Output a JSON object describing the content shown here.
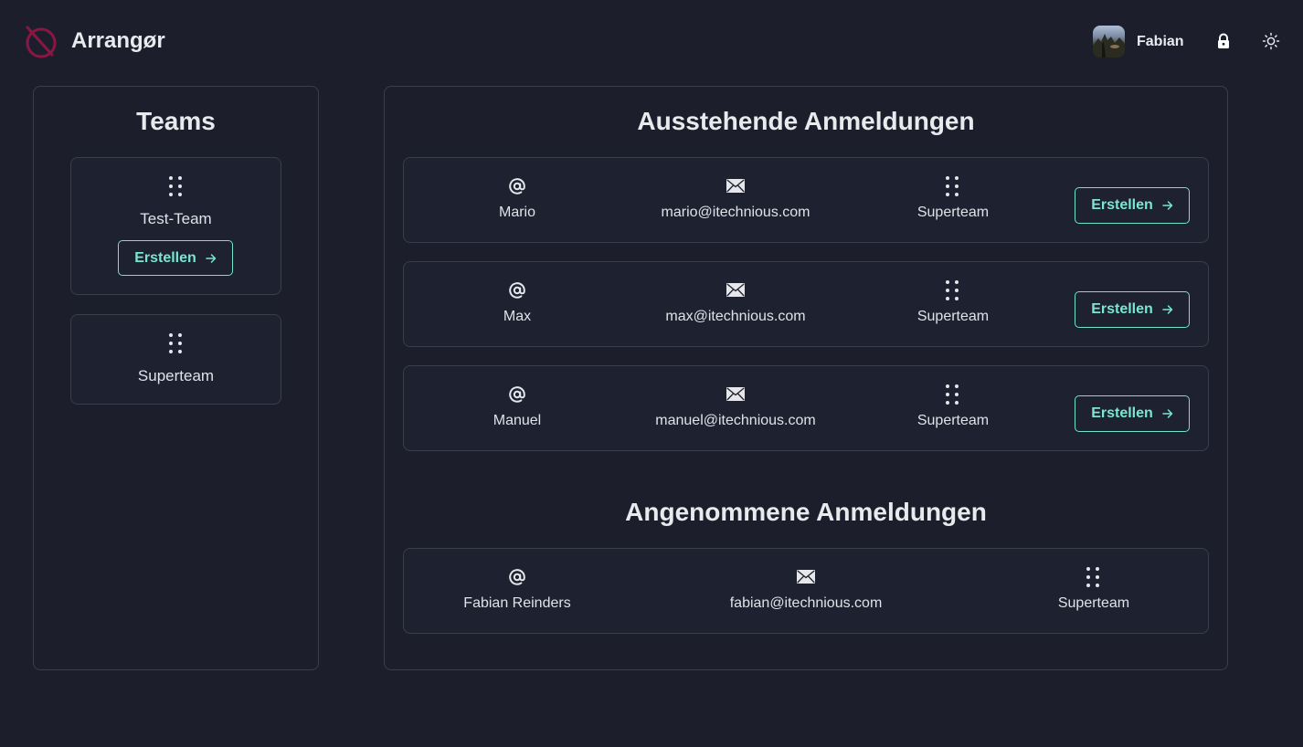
{
  "header": {
    "app_title": "Arrangør",
    "user_name": "Fabian",
    "icons": {
      "logo": "brand-logo-icon",
      "lock": "lock-icon",
      "theme": "sun-icon"
    }
  },
  "teams": {
    "title": "Teams",
    "items": [
      {
        "name": "Test-Team",
        "button_label": "Erstellen"
      },
      {
        "name": "Superteam"
      }
    ]
  },
  "pending": {
    "title": "Ausstehende Anmeldungen",
    "rows": [
      {
        "username": "Mario",
        "email": "mario@itechnious.com",
        "team": "Superteam",
        "button_label": "Erstellen"
      },
      {
        "username": "Max",
        "email": "max@itechnious.com",
        "team": "Superteam",
        "button_label": "Erstellen"
      },
      {
        "username": "Manuel",
        "email": "manuel@itechnious.com",
        "team": "Superteam",
        "button_label": "Erstellen"
      }
    ]
  },
  "accepted": {
    "title": "Angenommene Anmeldungen",
    "rows": [
      {
        "username": "Fabian Reinders",
        "email": "fabian@itechnious.com",
        "team": "Superteam"
      }
    ]
  },
  "colors": {
    "background": "#1c1f2b",
    "border": "#3a3e4b",
    "accent": "#6fe3cf",
    "logo": "#8a1743",
    "text": "#e6e7eb"
  }
}
